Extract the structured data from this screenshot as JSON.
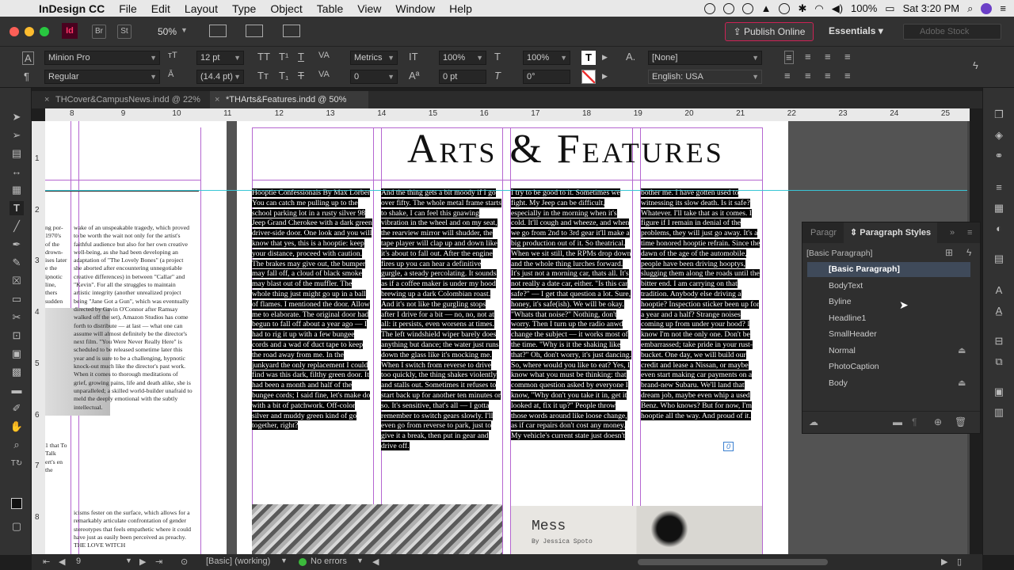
{
  "menubar": {
    "app": "InDesign CC",
    "items": [
      "File",
      "Edit",
      "Layout",
      "Type",
      "Object",
      "Table",
      "View",
      "Window",
      "Help"
    ],
    "battery": "100%",
    "clock": "Sat 3:20 PM"
  },
  "appbar": {
    "zoom": "50%",
    "publish": "Publish Online",
    "workspace": "Essentials",
    "search_placeholder": "Adobe Stock",
    "br": "Br",
    "st": "St"
  },
  "control": {
    "font": "Minion Pro",
    "style": "Regular",
    "size": "12 pt",
    "leading": "(14.4 pt)",
    "kerning": "Metrics",
    "tracking": "0",
    "vscale": "100%",
    "hscale": "100%",
    "baseline": "0 pt",
    "skew": "0°",
    "charstyle": "[None]",
    "language": "English: USA"
  },
  "tabs": [
    {
      "label": "THCover&CampusNews.indd @ 22%"
    },
    {
      "label": "*THArts&Features.indd @ 50%"
    }
  ],
  "ruler_h": [
    "8",
    "9",
    "10",
    "11",
    "12",
    "13",
    "14",
    "15",
    "16",
    "17",
    "18",
    "19",
    "20",
    "21",
    "22",
    "23",
    "24",
    "25"
  ],
  "ruler_v": [
    "1",
    "2",
    "3",
    "4",
    "5",
    "6",
    "7",
    "8"
  ],
  "page": {
    "title": "Arts & Features",
    "col1": "Hooptie Confessionals By Max Lorber You can catch me pulling up to the school parking lot in a rusty silver 98 Jeep Grand Cherokee with a dark green driver-side door. One look and you will know that yes, this is a hooptie: keep your distance, proceed with caution. The brakes may give out, the bumper may fall off, a cloud of black smoke may blast out of the muffler. The whole thing just might go up in a ball of flames. I mentioned the door. Allow me to elaborate. The original door had begun to fall off about a year ago — I had to rig it up with a few bungee cords and a wad of duct tape to keep the road away from me. In the junkyard the only replacement I could find was this dark, filthy green door. It had been a month and half of the bungee cords; I said fine, let's make do with a bit of patchwork. Off-color silver and muddy green kind of go together, right?",
    "col2": "And the thing gets a bit moody if I go over fifty. The whole metal frame starts to shake, I can feel this gnawing vibration in the wheel and on my seat, the rearview mirror will shudder, the tape player will clap up and down like it's about to fall out. After the engine fires up you can hear a definitive gurgle, a steady percolating. It sounds as if a coffee maker is under my hood brewing up a dark Colombian roast. And it's not like the gurgling stops after I drive for a bit — no, no, not at all: it persists, even worsens at times. The left windshield wiper barely does anything but dance; the water just runs down the glass like it's mocking me. When I switch from reverse to drive too quickly, the thing shakes violently and stalls out. Sometimes it refuses to start back up for another ten minutes or so. It's sensitive, that's all — I gotta remember to switch gears slowly. I'll even go from reverse to park, just to give it a break, then put in gear and drive off.",
    "col3": "I try to be good to it. Sometimes we fight. My Jeep can be difficult, especially in the morning when it's cold. It'll cough and wheeze, and when we go from 2nd to 3rd gear it'll make a big production out of it. So theatrical. When we sit still, the RPMs drop down and the whole thing lurches forward. It's just not a morning car, thats all. It's not really a date car, either. \"Is this car safe?\" — I get that question a lot. Sure, honey, it's safe(ish). We will be okay. \"Whats that noise?\" Nothing, don't worry. Then I turn up the radio anwd change the subject — it works most of the time. \"Why is it the shaking like that?\" Oh, don't worry, it's just dancing. So, where would you like to eat? Yes, I know what you must be thinking: that common question asked by everyone I know, \"Why don't you take it in, get it looked at, fix it up?\" People throw those words around like loose change, as if car repairs don't cost any money. My vehicle's current state just doesn't",
    "col4": "bother me. I have gotten used to witnessing its slow death. Is it safe? Whatever. I'll take that as it comes. I figure if I remain in denial of the problems, they will just go away. It's a time honored hooptie refrain. Since the dawn of the age of the automobile, people have been driving hooptys, slugging them along the roads until the bitter end. I am carrying on that tradition. Anybody else driving a hooptie? Inspection sticker been up for a year and a half? Strange noises coming up from under your hood? I know I'm not the only one. Don't be embarrassed; take pride in your rust-bucket. One day, we will build our credit and lease a Nissan, or maybe even start making car payments on a brand-new Subaru. We'll land that dream job, maybe even whip a used Benz. Who knows? But for now, I'm hooptie all the way. And proud of it.",
    "left_text_a": "wake of an unspeakable tragedy, which proved to be worth the wait not only for the artist's faithful audience but also for her own creative well-being, as she had been developing an adaptation of \"The Lovely Bones\" (a project she aborted after encountering unnegotiable creative differences) in between \"Callar\" and \"Kevin\". For all the struggles to maintain artistic integrity (another unrealized project being \"Jane Got a Gun\", which was eventually directed by Gavin O'Connor after Ramsay walked off the set), Amazon Studios has come forth to distribute — at last — what one can assume will almost definitely be the director's next film. \"You Were Never Really Here\" is scheduled to be released sometime later this year and is sure to be a challenging, hypnotic knock-out much like the director's past work. When it comes to thorough meditations of grief, growing pains, life and death alike, she is unparalleled; a skilled world-builder unafraid to meld the deeply emotional with the subtly intellectual.",
    "left_text_b": "icisms fester on the surface, which allows for a remarkably articulate confrontation of gender stereotypes that feels empathetic where it could have just as easily been perceived as preachy. THE LOVE WITCH",
    "left_edge": "ng por- 1970's of the drown- ises later e the ipnotic line, thers sudden",
    "left_edge2": "1 that To Talk ert's en the",
    "mess_title": "Mess",
    "mess_byline": "By Jessica Spoto",
    "overset": "0"
  },
  "panel": {
    "tab_inactive": "Paragr",
    "tab_active": "Paragraph Styles",
    "current": "[Basic Paragraph]",
    "items": [
      "[Basic Paragraph]",
      "BodyText",
      "Byline",
      "Headline1",
      "SmallHeader",
      "Normal",
      "PhotoCaption",
      "Body"
    ]
  },
  "status": {
    "page": "9",
    "profile": "[Basic] (working)",
    "errors": "No errors"
  },
  "colors": {
    "accent_publish": "#c22255",
    "guide": "#b566d0",
    "selection": "#3f4a5a",
    "ok": "#3cba3c"
  }
}
